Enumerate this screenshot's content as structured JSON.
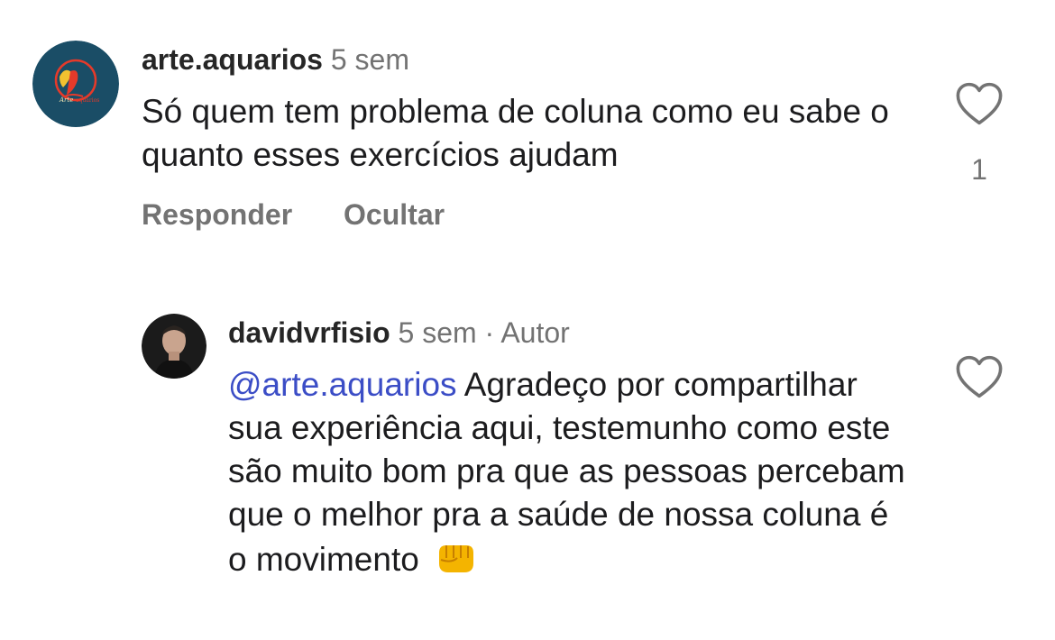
{
  "comments": [
    {
      "username": "arte.aquarios",
      "time": "5 sem",
      "text": "Só quem tem problema de coluna como eu sabe o quanto esses exercícios ajudam",
      "like_count": "1",
      "actions": {
        "reply": "Responder",
        "hide": "Ocultar"
      },
      "avatar_icon": "arte-aquarios-logo",
      "avatar_color": "#1a4d66"
    },
    {
      "username": "davidvrfisio",
      "time": "5 sem",
      "separator": "·",
      "author_badge": "Autor",
      "mention": "@arte.aquarios",
      "text": "Agradeço por compartilhar sua experiência aqui, testemunho como este são muito bom pra que as pessoas percebam que o melhor pra a saúde de nossa coluna é o movimento",
      "emoji_icon": "oncoming-fist-emoji",
      "avatar_icon": "profile-photo"
    }
  ],
  "colors": {
    "mention": "#3b4dc6",
    "muted": "#737373",
    "text": "#1c1c1e"
  }
}
